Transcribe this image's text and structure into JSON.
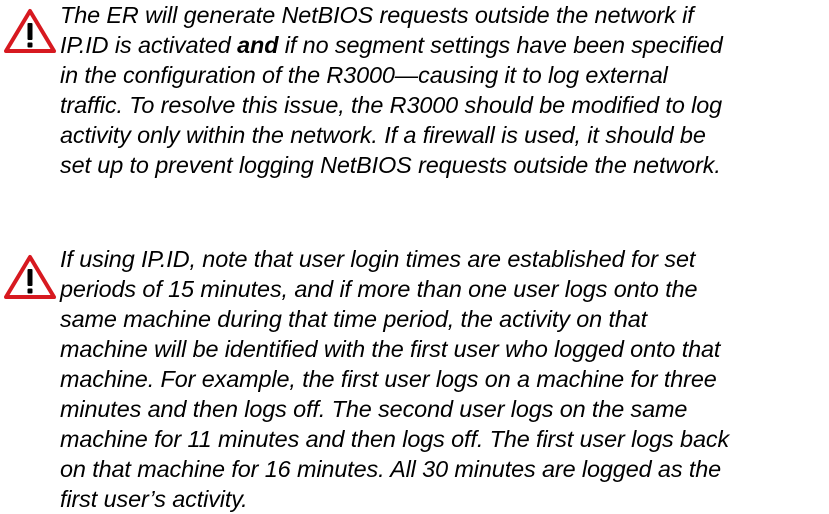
{
  "icon": {
    "name": "warning-icon",
    "fill": "#ffffff",
    "stroke": "#d71920",
    "mark": "#000000",
    "shadow": "#b0b0b0"
  },
  "notes": [
    {
      "lines": [
        {
          "text": "The ER will generate NetBIOS requests outside the network if"
        },
        {
          "pre": "IP.ID is activated ",
          "bold": "and",
          "post": " if no segment settings have been specified"
        },
        {
          "text": "in the configuration of the R3000—causing it to log external"
        },
        {
          "text": "traffic. To resolve this issue, the R3000 should be modified to log"
        },
        {
          "text": "activity only within the network. If a firewall is used, it should be"
        },
        {
          "text": "set up to prevent logging NetBIOS requests outside the network."
        }
      ]
    },
    {
      "lines": [
        {
          "text": "If using IP.ID, note that user login times are established for set"
        },
        {
          "text": "periods of 15 minutes, and if more than one user logs onto the"
        },
        {
          "text": "same machine during that time period, the activity on that"
        },
        {
          "text": "machine will be identified with the first user who logged onto that"
        },
        {
          "text": "machine. For example, the first user logs on a machine for three"
        },
        {
          "text": "minutes and then logs off. The second user logs on the same"
        },
        {
          "text": "machine for 11 minutes and then logs off. The first user logs back"
        },
        {
          "text": "on that machine for 16 minutes. All 30 minutes are logged as the"
        },
        {
          "text": "first user’s activity."
        }
      ]
    }
  ]
}
